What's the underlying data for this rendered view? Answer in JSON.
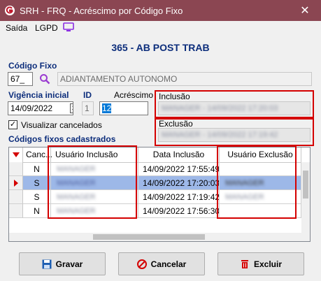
{
  "window": {
    "title": "SRH - FRQ - Acréscimo por Código Fixo",
    "close_label": "✕"
  },
  "menu": {
    "items": [
      "Saída",
      "LGPD"
    ]
  },
  "header": {
    "title": "365 - AB POST TRAB"
  },
  "codigo_fixo": {
    "label": "Código Fixo",
    "value": "67_",
    "description": "ADIANTAMENTO AUTONOMO"
  },
  "vigencia": {
    "label": "Vigência inicial",
    "value": "14/09/2022",
    "picker_label": "19"
  },
  "id_field": {
    "label": "ID",
    "value": "1"
  },
  "acrescimo": {
    "label": "Acréscimo",
    "value": "12"
  },
  "inclusao": {
    "label": "Inclusão",
    "value": "MANAGER - 14/09/2022 17:20:03"
  },
  "exclusao": {
    "label": "Exclusão",
    "value": "MANAGER - 14/09/2022 17:19:42"
  },
  "visualizar": {
    "label": "Visualizar cancelados",
    "checked": true
  },
  "grid": {
    "title": "Códigos fixos cadastrados",
    "columns": [
      "Canc...",
      "Usuário Inclusão",
      "Data Inclusão",
      "Usuário Exclusão"
    ],
    "rows": [
      {
        "canc": "N",
        "usuario_inclusao": "MANAGER",
        "data_inclusao": "14/09/2022 17:55:49",
        "usuario_exclusao": ""
      },
      {
        "canc": "S",
        "usuario_inclusao": "MANAGER",
        "data_inclusao": "14/09/2022 17:20:03",
        "usuario_exclusao": "MANAGER"
      },
      {
        "canc": "S",
        "usuario_inclusao": "MANAGER",
        "data_inclusao": "14/09/2022 17:19:42",
        "usuario_exclusao": "MANAGER"
      },
      {
        "canc": "N",
        "usuario_inclusao": "MANAGER",
        "data_inclusao": "14/09/2022 17:56:30",
        "usuario_exclusao": ""
      }
    ],
    "selected_row": 1
  },
  "buttons": {
    "gravar": "Gravar",
    "cancelar": "Cancelar",
    "excluir": "Excluir"
  },
  "colors": {
    "titlebar": "#8b4652",
    "label_blue": "#0c2d7b",
    "highlight": "#d40000",
    "selected_row": "#9db8e8"
  }
}
